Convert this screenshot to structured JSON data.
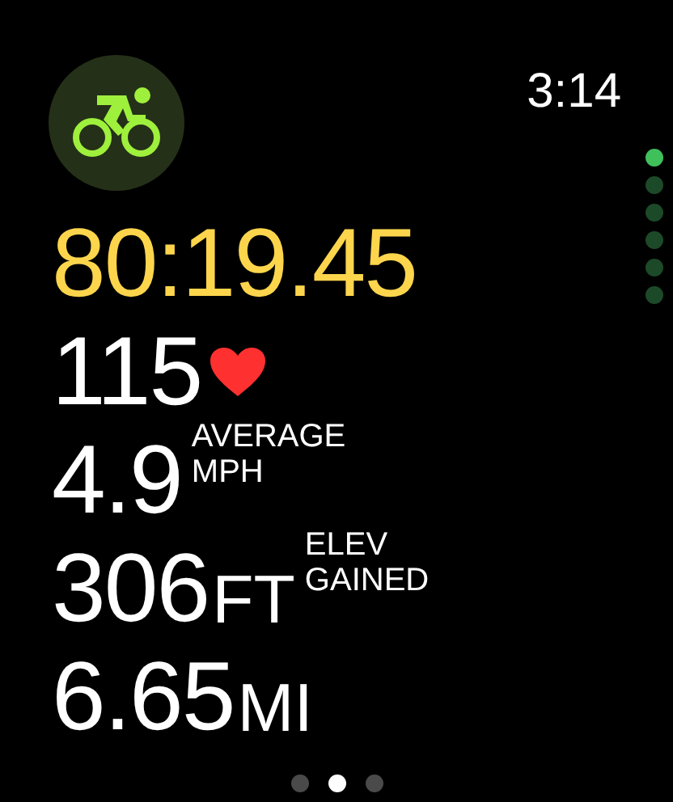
{
  "status_bar": {
    "time": "3:14"
  },
  "workout": {
    "kind": "cycling"
  },
  "metrics": [
    {
      "kind": "elapsed",
      "value": "80:19.45"
    },
    {
      "kind": "heart_rate",
      "value": "115"
    },
    {
      "kind": "metric",
      "value": "4.9",
      "label": [
        "AVERAGE",
        "MPH"
      ]
    },
    {
      "kind": "metric",
      "value": "306",
      "unit": "FT",
      "label": [
        "ELEV",
        "GAINED"
      ]
    },
    {
      "kind": "metric",
      "value": "6.65",
      "unit": "MI"
    }
  ],
  "side_pages": [
    {
      "selected": true
    },
    {
      "selected": false
    },
    {
      "selected": false
    },
    {
      "selected": false
    },
    {
      "selected": false
    },
    {
      "selected": false
    }
  ],
  "pages": [
    {
      "selected": false
    },
    {
      "selected": true
    },
    {
      "selected": false
    }
  ]
}
